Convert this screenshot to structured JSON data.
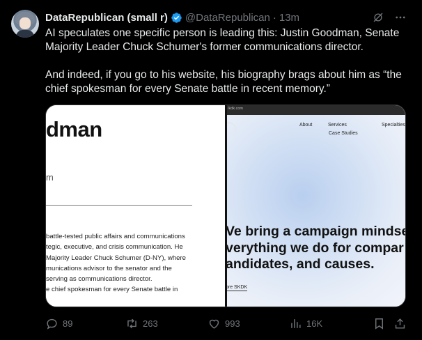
{
  "tweet": {
    "display_name": "DataRepublican (small r)",
    "handle": "@DataRepublican",
    "separator": "·",
    "timestamp": "13m",
    "paragraph_1": "AI speculates one specific person is leading this: Justin Goodman, Senate Majority Leader Chuck Schumer's former communications director.",
    "paragraph_2": "And indeed, if you go to his website, his biography brags about him as “the chief spokesman for every Senate battle in recent memory.”",
    "icons": {
      "verified": "verified-badge-icon",
      "grok": "grok-icon",
      "more": "more-icon"
    }
  },
  "media": {
    "left": {
      "title_fragment": "dman",
      "subtitle_fragment": "m",
      "bio_lines": [
        "battle-tested public affairs and communications",
        "tegic, executive, and crisis communication. He",
        "Majority Leader Chuck Schumer (D-NY), where",
        "munications advisor to the senator and the",
        "serving as communications director.",
        "e chief spokesman for every Senate battle in"
      ]
    },
    "right": {
      "url": "/kdk.com",
      "nav": {
        "about": "About",
        "services": "Services",
        "specialties": "Specialties",
        "case_studies": "Case Studies"
      },
      "hero_lines": [
        "Ve bring a campaign mindse",
        "verything we do for compar",
        "andidates, and causes."
      ],
      "explore_link": "ore SKDK"
    }
  },
  "engagement": {
    "replies": "89",
    "reposts": "263",
    "likes": "993",
    "views": "16K"
  },
  "colors": {
    "background": "#000000",
    "text_primary": "#e7e9ea",
    "text_secondary": "#71767b",
    "verified_blue": "#1d9bf0"
  }
}
